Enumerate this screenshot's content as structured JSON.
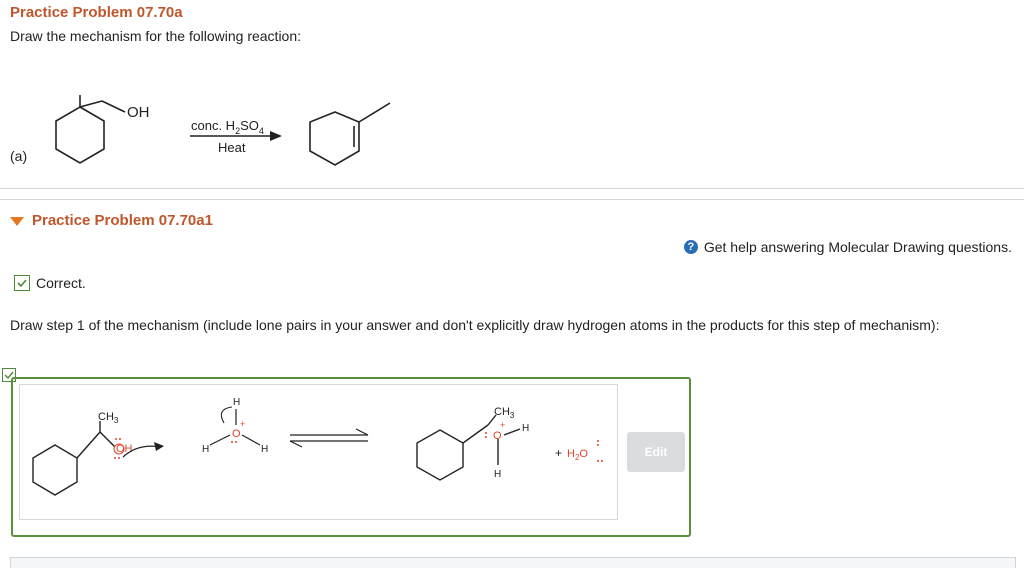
{
  "problem": {
    "title": "Practice Problem 07.70a",
    "instruction": "Draw the mechanism for the following reaction:"
  },
  "reaction": {
    "part_label": "(a)",
    "reactant_group": "OH",
    "reagent_prefix": "conc. H",
    "reagent_sub2": "2",
    "reagent_mid": "SO",
    "reagent_sub4": "4",
    "condition": "Heat"
  },
  "subproblem": {
    "title": "Practice Problem 07.70a1"
  },
  "help": {
    "icon": "?",
    "text": "Get help answering Molecular Drawing questions."
  },
  "status": {
    "label": "Correct."
  },
  "step": {
    "text": "Draw step 1 of the mechanism (include lone pairs in your answer and don't explicitly draw hydrogen atoms in the products for this step of mechanism):"
  },
  "drawing": {
    "ch3_left": "CH",
    "ch3_left_sub": "3",
    "oh_left": "OH",
    "h_top": "H",
    "o_center": "O",
    "plus_center": "+",
    "h_left": "H",
    "h_right": "H",
    "ch3_right": "CH",
    "ch3_right_sub": "3",
    "o_right": "O",
    "plus_right": "+",
    "h_right_top": "H",
    "h_right_bottom": "H",
    "plus_water": "+",
    "water_h": "H",
    "water_sub": "2",
    "water_o": "O"
  },
  "edit_button": {
    "label": "Edit"
  },
  "colors": {
    "title": "#c0562b",
    "caret": "#e87722",
    "correct_border": "#5a8f3c",
    "help_icon": "#2a6db5",
    "atom_red": "#e0442b"
  }
}
